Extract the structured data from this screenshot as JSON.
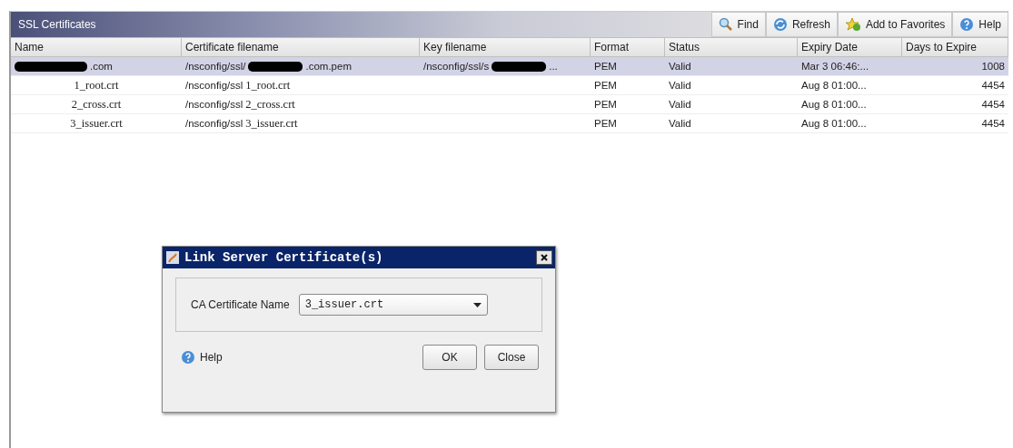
{
  "panel": {
    "title": "SSL Certificates"
  },
  "toolbar": [
    {
      "label": "Find"
    },
    {
      "label": "Refresh"
    },
    {
      "label": "Add to Favorites"
    },
    {
      "label": "Help"
    }
  ],
  "table": {
    "columns": [
      "Name",
      "Certificate filename",
      "Key filename",
      "Format",
      "Status",
      "Expiry Date",
      "Days to Expire"
    ],
    "rows": [
      {
        "selected": true,
        "cells": [
          [
            {
              "kind": "redacted"
            },
            {
              "kind": "plain",
              "text": ".com"
            }
          ],
          [
            {
              "kind": "plain",
              "text": "/nsconfig/ssl/"
            },
            {
              "kind": "redacted"
            },
            {
              "kind": "plain",
              "text": ".com.pem"
            }
          ],
          [
            {
              "kind": "plain",
              "text": "/nsconfig/ssl/s"
            },
            {
              "kind": "redacted"
            },
            {
              "kind": "plain",
              "text": "..."
            }
          ],
          [
            {
              "kind": "plain",
              "text": "PEM"
            }
          ],
          [
            {
              "kind": "plain",
              "text": "Valid"
            }
          ],
          [
            {
              "kind": "plain",
              "text": "Mar  3 06:46:..."
            }
          ],
          [
            {
              "kind": "plain",
              "text": "1008"
            }
          ]
        ]
      },
      {
        "selected": false,
        "cells": [
          [
            {
              "kind": "serif",
              "text": "1_root.crt"
            }
          ],
          [
            {
              "kind": "plain",
              "text": "/nsconfig/ssl"
            },
            {
              "kind": "serif",
              "text": "1_root.crt"
            }
          ],
          [],
          [
            {
              "kind": "plain",
              "text": "PEM"
            }
          ],
          [
            {
              "kind": "plain",
              "text": "Valid"
            }
          ],
          [
            {
              "kind": "plain",
              "text": "Aug  8 01:00..."
            }
          ],
          [
            {
              "kind": "plain",
              "text": "4454"
            }
          ]
        ]
      },
      {
        "selected": false,
        "cells": [
          [
            {
              "kind": "serif",
              "text": "2_cross.crt"
            }
          ],
          [
            {
              "kind": "plain",
              "text": "/nsconfig/ssl"
            },
            {
              "kind": "serif",
              "text": "2_cross.crt"
            }
          ],
          [],
          [
            {
              "kind": "plain",
              "text": "PEM"
            }
          ],
          [
            {
              "kind": "plain",
              "text": "Valid"
            }
          ],
          [
            {
              "kind": "plain",
              "text": "Aug  8 01:00..."
            }
          ],
          [
            {
              "kind": "plain",
              "text": "4454"
            }
          ]
        ]
      },
      {
        "selected": false,
        "cells": [
          [
            {
              "kind": "serif",
              "text": "3_issuer.crt"
            }
          ],
          [
            {
              "kind": "plain",
              "text": "/nsconfig/ssl"
            },
            {
              "kind": "serif",
              "text": "3_issuer.crt"
            }
          ],
          [],
          [
            {
              "kind": "plain",
              "text": "PEM"
            }
          ],
          [
            {
              "kind": "plain",
              "text": "Valid"
            }
          ],
          [
            {
              "kind": "plain",
              "text": "Aug  8 01:00..."
            }
          ],
          [
            {
              "kind": "plain",
              "text": "4454"
            }
          ]
        ]
      }
    ]
  },
  "dialog": {
    "title": "Link Server Certificate(s)",
    "field_label": "CA Certificate Name",
    "field_value": "3_issuer.crt",
    "help": "Help",
    "buttons": [
      "OK",
      "Close"
    ]
  }
}
